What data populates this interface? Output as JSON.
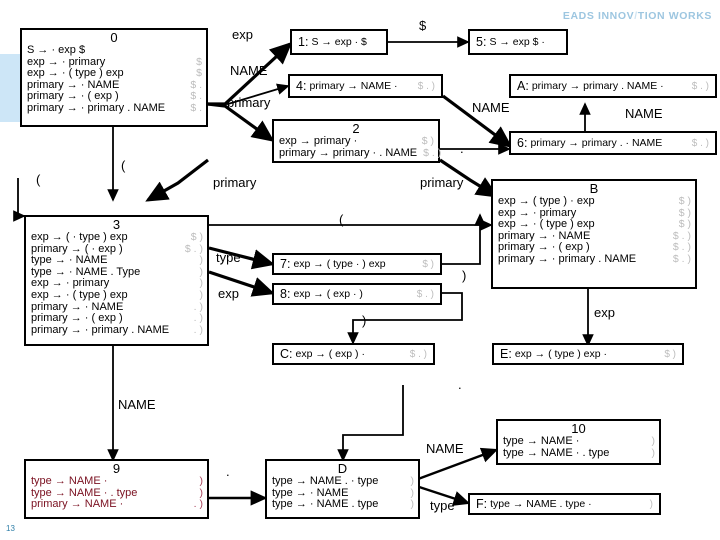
{
  "logo": {
    "text_a": "EADS INNOV",
    "slash": "/",
    "text_b": "TION WORKS"
  },
  "page_number": "13",
  "nodes": {
    "s0": {
      "title": "0",
      "rows": [
        {
          "prod": "S → · exp $",
          "look": ""
        },
        {
          "prod": "exp → · primary",
          "look": "$"
        },
        {
          "prod": "exp → · ( type ) exp",
          "look": "$"
        },
        {
          "prod": "primary → · NAME",
          "look": "$ ."
        },
        {
          "prod": "primary → · ( exp )",
          "look": "$ ."
        },
        {
          "prod": "primary → · primary . NAME",
          "look": "$ ."
        }
      ]
    },
    "s1": {
      "label": "1:",
      "prod": "S → exp · $",
      "look": ""
    },
    "s5": {
      "label": "5:",
      "prod": "S → exp $ ·",
      "look": ""
    },
    "s4": {
      "label": "4:",
      "prod": "primary → NAME ·",
      "look": "$ . )"
    },
    "sA": {
      "label": "A:",
      "prod": "primary → primary . NAME ·",
      "look": "$ . )"
    },
    "s6": {
      "label": "6:",
      "prod": "primary → primary . · NAME",
      "look": "$ . )"
    },
    "s2": {
      "title": "2",
      "rows": [
        {
          "prod": "exp → primary ·",
          "look": "$ )"
        },
        {
          "prod": "primary → primary · . NAME",
          "look": "$ . )"
        }
      ]
    },
    "s3": {
      "title": "3",
      "rows": [
        {
          "prod": "exp → ( · type ) exp",
          "look": "$ )"
        },
        {
          "prod": "primary → ( · exp )",
          "look": "$ . )"
        },
        {
          "prod": "type → · NAME",
          "look": ")"
        },
        {
          "prod": "type → · NAME . Type",
          "look": ")"
        },
        {
          "prod": "exp → · primary",
          "look": ")"
        },
        {
          "prod": "exp → · ( type ) exp",
          "look": ")"
        },
        {
          "prod": "primary → · NAME",
          "look": ". )"
        },
        {
          "prod": "primary → · ( exp )",
          "look": ". )"
        },
        {
          "prod": "primary → · primary . NAME",
          "look": ". )"
        }
      ]
    },
    "sB": {
      "title": "B",
      "rows": [
        {
          "prod": "exp → ( type ) · exp",
          "look": "$ )"
        },
        {
          "prod": "exp → · primary",
          "look": "$ )"
        },
        {
          "prod": "exp → · ( type ) exp",
          "look": "$ )"
        },
        {
          "prod": "primary → · NAME",
          "look": "$ . )"
        },
        {
          "prod": "primary → · ( exp )",
          "look": "$ . )"
        },
        {
          "prod": "primary → · primary . NAME",
          "look": "$ . )"
        }
      ]
    },
    "s7": {
      "label": "7:",
      "prod": "exp → ( type · ) exp",
      "look": "$ )"
    },
    "s8": {
      "label": "8:",
      "prod": "exp → ( exp · )",
      "look": "$ . )"
    },
    "sC": {
      "label": "C:",
      "prod": "exp → ( exp ) ·",
      "look": "$ . )"
    },
    "sE": {
      "label": "E:",
      "prod": "exp → ( type ) exp ·",
      "look": "$ )"
    },
    "s9": {
      "title": "9",
      "rows": [
        {
          "prod": "type → NAME ·",
          "look": ")"
        },
        {
          "prod": "type → NAME · . type",
          "look": ")"
        },
        {
          "prod": "primary → NAME ·",
          "look": ". )"
        }
      ]
    },
    "sD": {
      "title": "D",
      "rows": [
        {
          "prod": "type → NAME . · type",
          "look": ")"
        },
        {
          "prod": "type → · NAME",
          "look": ")"
        },
        {
          "prod": "type → · NAME . type",
          "look": ")"
        }
      ]
    },
    "s10": {
      "title": "10",
      "rows": [
        {
          "prod": "type → NAME ·",
          "look": ")"
        },
        {
          "prod": "type → NAME · . type",
          "look": ")"
        }
      ]
    },
    "sF": {
      "label": "F:",
      "prod": "type → NAME . type ·",
      "look": ")"
    }
  },
  "edge_labels": {
    "e_exp_top": "exp",
    "e_dollar_top": "$",
    "e_name_0_4": "NAME",
    "e_primary_0_2": "primary",
    "e_name_4_6": "NAME",
    "e_name_6_A": "NAME",
    "e_dot_2_6": ".",
    "e_paren_0_3": "(",
    "e_paren_left": "(",
    "e_primary_3_2": "primary",
    "e_primary_2_B": "primary",
    "e_paren_3_B": "(",
    "e_type_3_7": "type",
    "e_exp_3_8": "exp",
    "e_rparen_7": ")",
    "e_rparen_8": ")",
    "e_exp_B_E": "exp",
    "e_name_3_9": "NAME",
    "e_dot_9_D": ".",
    "e_dot_right": ".",
    "e_name_D_10": "NAME",
    "e_type_D_F": "type"
  }
}
